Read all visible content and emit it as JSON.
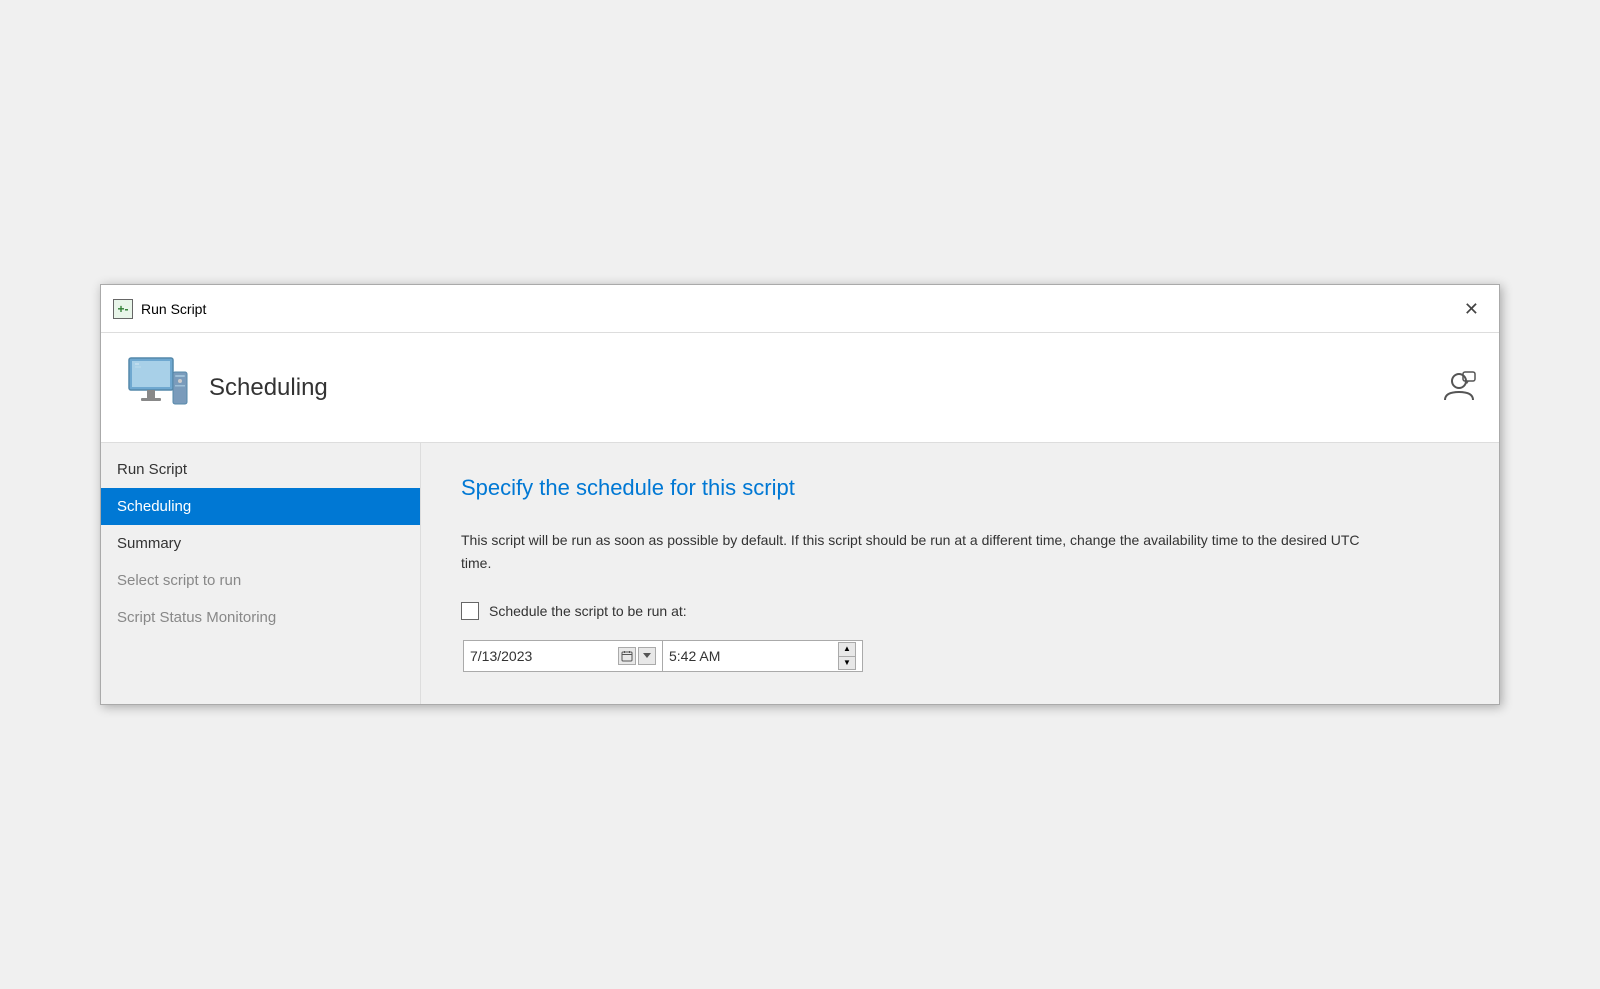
{
  "titleBar": {
    "icon": "+-",
    "title": "Run Script",
    "closeLabel": "✕"
  },
  "header": {
    "title": "Scheduling",
    "userIconLabel": "👤"
  },
  "sidebar": {
    "items": [
      {
        "id": "run-script",
        "label": "Run Script",
        "state": "normal"
      },
      {
        "id": "scheduling",
        "label": "Scheduling",
        "state": "active"
      },
      {
        "id": "summary",
        "label": "Summary",
        "state": "normal"
      },
      {
        "id": "select-script",
        "label": "Select script to run",
        "state": "disabled"
      },
      {
        "id": "script-status",
        "label": "Script Status Monitoring",
        "state": "disabled"
      }
    ]
  },
  "content": {
    "heading": "Specify the schedule for this script",
    "description": "This script will be run as soon as possible by default. If this script should be run at a different time, change the availability time to the desired UTC time.",
    "checkboxLabel": "Schedule the script to be run at:",
    "checkboxChecked": false,
    "dateValue": "7/13/2023",
    "timeValue": "5:42 AM"
  }
}
